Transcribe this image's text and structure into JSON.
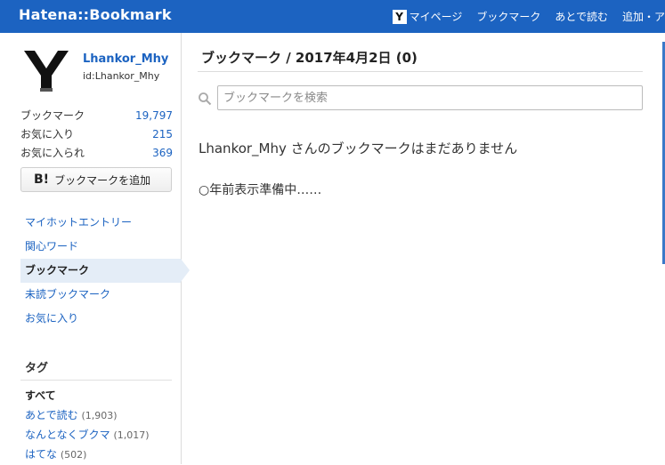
{
  "header": {
    "logo": "Hatena::Bookmark",
    "nav": {
      "mypage_icon": "Y",
      "mypage": "マイページ",
      "bookmark": "ブックマーク",
      "read_later": "あとで読む",
      "add": "追加・ア"
    }
  },
  "sidebar": {
    "user": {
      "name": "Lhankor_Mhy",
      "id": "id:Lhankor_Mhy"
    },
    "stats": [
      {
        "label": "ブックマーク",
        "value": "19,797"
      },
      {
        "label": "お気に入り",
        "value": "215"
      },
      {
        "label": "お気に入られ",
        "value": "369"
      }
    ],
    "add_button": {
      "mark": "B!",
      "label": "ブックマークを追加"
    },
    "nav": [
      {
        "label": "マイホットエントリー"
      },
      {
        "label": "関心ワード"
      },
      {
        "label": "ブックマーク"
      },
      {
        "label": "未読ブックマーク"
      },
      {
        "label": "お気に入り"
      }
    ],
    "tags": {
      "heading": "タグ",
      "all": "すべて",
      "items": [
        {
          "name": "あとで読む",
          "count": "(1,903)"
        },
        {
          "name": "なんとなくブクマ",
          "count": "(1,017)"
        },
        {
          "name": "はてな",
          "count": "(502)"
        }
      ]
    }
  },
  "main": {
    "title": "ブックマーク / 2017年4月2日 (0)",
    "search": {
      "placeholder": "ブックマークを検索",
      "value": ""
    },
    "empty_message": "Lhankor_Mhy さんのブックマークはまだありません",
    "loading_text": "○年前表示準備中……"
  },
  "colors": {
    "header_bg": "#1c63c1",
    "link": "#1c63c1",
    "active_nav_bg": "#e4edf7"
  }
}
